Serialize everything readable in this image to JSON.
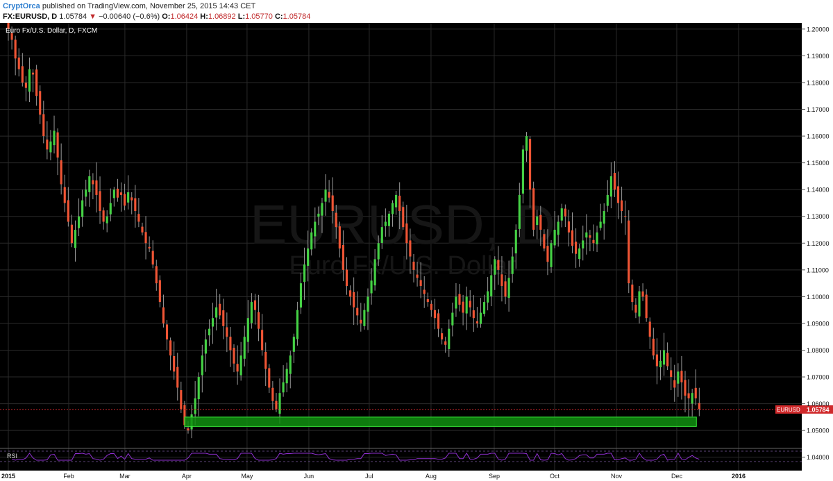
{
  "header": {
    "author": "CryptOrca",
    "published": "published on TradingView.com, November 25, 2015 14:43 CET",
    "symbol": "FX:EURUSD, D",
    "last": "1.05784",
    "change_arrow": "▼",
    "change": "−0.00640 (−0.6%)",
    "o_label": "O:",
    "o_value": "1.06424",
    "h_label": "H:",
    "h_value": "1.06892",
    "l_label": "L:",
    "l_value": "1.05770",
    "c_label": "C:",
    "c_value": "1.05784"
  },
  "chart_data": {
    "type": "candlestick",
    "title": "Euro Fx/U.S. Dollar, D, FXCM",
    "watermark_symbol": "EURUSD, D",
    "watermark_name": "Euro Fx/U.S. Dollar",
    "ylim": [
      1.035,
      1.201
    ],
    "y_ticks": [
      "1.20000",
      "1.19000",
      "1.18000",
      "1.17000",
      "1.16000",
      "1.15000",
      "1.14000",
      "1.13000",
      "1.12000",
      "1.11000",
      "1.10000",
      "1.09000",
      "1.08000",
      "1.07000",
      "1.06000",
      "1.05000",
      "1.04000"
    ],
    "x_labels": [
      {
        "label": "2015",
        "week": 0
      },
      {
        "label": "Feb",
        "week": 4.3
      },
      {
        "label": "Mar",
        "week": 8.3
      },
      {
        "label": "Apr",
        "week": 12.7
      },
      {
        "label": "May",
        "week": 17
      },
      {
        "label": "Jun",
        "week": 21.4
      },
      {
        "label": "Jul",
        "week": 25.7
      },
      {
        "label": "Aug",
        "week": 30.1
      },
      {
        "label": "Sep",
        "week": 34.6
      },
      {
        "label": "Oct",
        "week": 38.9
      },
      {
        "label": "Nov",
        "week": 43.3
      },
      {
        "label": "Dec",
        "week": 47.6
      },
      {
        "label": "2016",
        "week": 52
      }
    ],
    "x_range_weeks": [
      0,
      56.5
    ],
    "closes": [
      1.2,
      1.196,
      1.189,
      1.185,
      1.18,
      1.178,
      1.185,
      1.183,
      1.175,
      1.168,
      1.16,
      1.155,
      1.158,
      1.162,
      1.152,
      1.142,
      1.135,
      1.128,
      1.12,
      1.125,
      1.13,
      1.136,
      1.14,
      1.145,
      1.142,
      1.138,
      1.132,
      1.128,
      1.13,
      1.135,
      1.14,
      1.137,
      1.138,
      1.134,
      1.139,
      1.136,
      1.132,
      1.128,
      1.124,
      1.12,
      1.118,
      1.112,
      1.105,
      1.098,
      1.09,
      1.084,
      1.078,
      1.072,
      1.066,
      1.058,
      1.052,
      1.05,
      1.056,
      1.062,
      1.07,
      1.078,
      1.084,
      1.088,
      1.092,
      1.096,
      1.093,
      1.089,
      1.085,
      1.08,
      1.075,
      1.072,
      1.078,
      1.085,
      1.092,
      1.098,
      1.095,
      1.088,
      1.08,
      1.073,
      1.066,
      1.061,
      1.058,
      1.064,
      1.068,
      1.073,
      1.078,
      1.085,
      1.095,
      1.105,
      1.112,
      1.118,
      1.124,
      1.128,
      1.131,
      1.135,
      1.14,
      1.137,
      1.132,
      1.126,
      1.118,
      1.11,
      1.104,
      1.1,
      1.096,
      1.093,
      1.09,
      1.095,
      1.1,
      1.106,
      1.114,
      1.12,
      1.126,
      1.128,
      1.131,
      1.135,
      1.138,
      1.132,
      1.126,
      1.12,
      1.115,
      1.11,
      1.107,
      1.104,
      1.101,
      1.098,
      1.095,
      1.092,
      1.088,
      1.084,
      1.082,
      1.088,
      1.094,
      1.1,
      1.097,
      1.094,
      1.1,
      1.096,
      1.092,
      1.09,
      1.094,
      1.098,
      1.102,
      1.108,
      1.114,
      1.11,
      1.104,
      1.1,
      1.107,
      1.115,
      1.125,
      1.138,
      1.155,
      1.16,
      1.14,
      1.125,
      1.13,
      1.125,
      1.118,
      1.113,
      1.12,
      1.125,
      1.128,
      1.133,
      1.13,
      1.124,
      1.119,
      1.116,
      1.118,
      1.121,
      1.124,
      1.122,
      1.12,
      1.124,
      1.128,
      1.132,
      1.138,
      1.145,
      1.14,
      1.135,
      1.132,
      1.13,
      1.105,
      1.098,
      1.094,
      1.102,
      1.1,
      1.092,
      1.085,
      1.078,
      1.074,
      1.076,
      1.08,
      1.074,
      1.07,
      1.066,
      1.072,
      1.068,
      1.063,
      1.062,
      1.064,
      1.062,
      1.058
    ],
    "support_zone": {
      "low": 1.0515,
      "high": 1.055,
      "from_week": 12.55,
      "to_week": 49
    },
    "current_price": {
      "label": "EURUSD",
      "value": "1.05784",
      "price": 1.05784
    },
    "indicator": {
      "label": "RSI"
    }
  },
  "colors": {
    "background": "#000000",
    "up": "#45d245",
    "down": "#f05535",
    "wick": "#9a9a9a",
    "grid": "#2a2a2a",
    "axis_bg": "#ffffff",
    "price_line": "#d0292b",
    "zone_fill": "#109010",
    "zone_stroke": "#36e336",
    "rsi": "#8f2fd0"
  }
}
